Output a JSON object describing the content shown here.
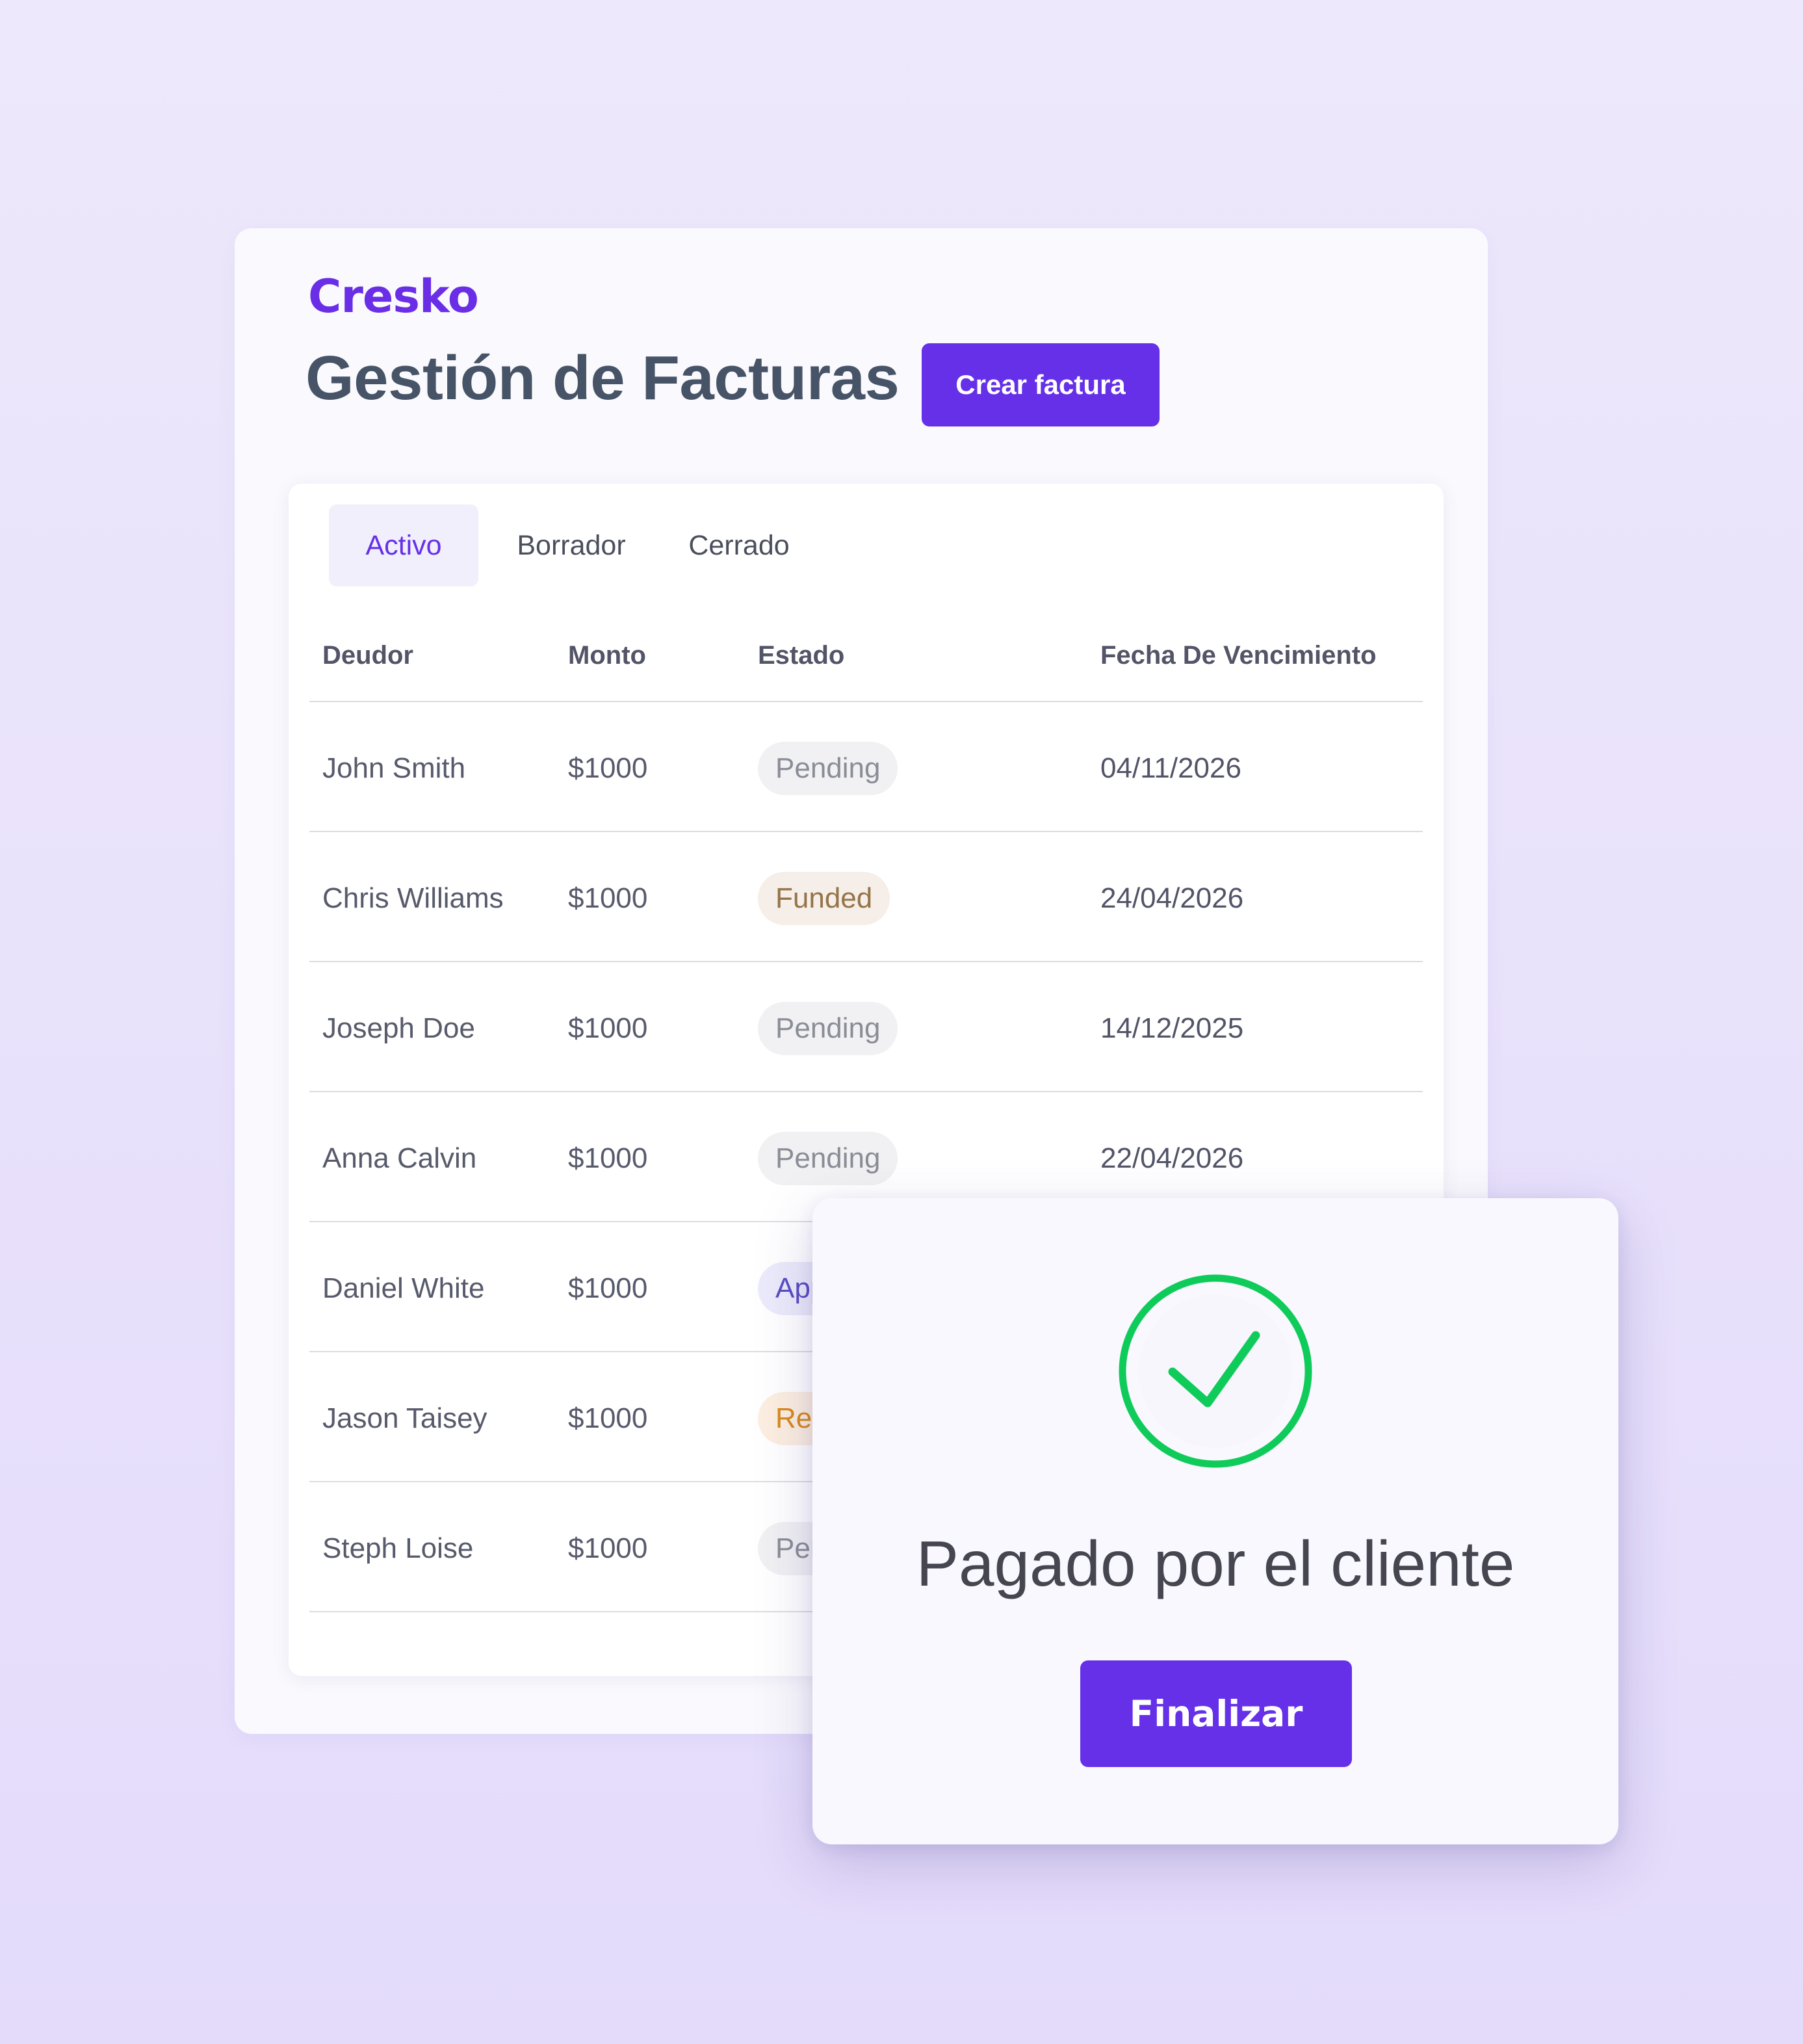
{
  "brand": {
    "name": "Cresko"
  },
  "header": {
    "title": "Gestión de Facturas",
    "create_button": "Crear factura"
  },
  "tabs": [
    {
      "label": "Activo",
      "active": true
    },
    {
      "label": "Borrador",
      "active": false
    },
    {
      "label": "Cerrado",
      "active": false
    }
  ],
  "table": {
    "columns": [
      "Deudor",
      "Monto",
      "Estado",
      "Fecha De Vencimiento"
    ],
    "rows": [
      {
        "debtor": "John Smith",
        "amount": "$1000",
        "status": "Pending",
        "due": "04/11/2026"
      },
      {
        "debtor": "Chris Williams",
        "amount": "$1000",
        "status": "Funded",
        "due": "24/04/2026"
      },
      {
        "debtor": "Joseph Doe",
        "amount": "$1000",
        "status": "Pending",
        "due": "14/12/2025"
      },
      {
        "debtor": "Anna Calvin",
        "amount": "$1000",
        "status": "Pending",
        "due": "22/04/2026"
      },
      {
        "debtor": "Daniel White",
        "amount": "$1000",
        "status": "App",
        "due": ""
      },
      {
        "debtor": "Jason Taisey",
        "amount": "$1000",
        "status": "Rec",
        "due": ""
      },
      {
        "debtor": "Steph Loise",
        "amount": "$1000",
        "status": "Pen",
        "due": ""
      }
    ]
  },
  "status_colors": {
    "pending": {
      "text": "#8a8d96",
      "bg": "#f1f1f3"
    },
    "funded": {
      "text": "#957448",
      "bg": "#f6eee8"
    },
    "approved": {
      "text": "#5a4cc4",
      "bg": "#ecebfb"
    },
    "review": {
      "text": "#d98a1a",
      "bg": "#fcefe0"
    }
  },
  "modal": {
    "icon": "check-circle-icon",
    "title": "Pagado por el cliente",
    "button": "Finalizar"
  },
  "colors": {
    "accent": "#6530e8",
    "success": "#0fcc5a",
    "title": "#475467"
  }
}
